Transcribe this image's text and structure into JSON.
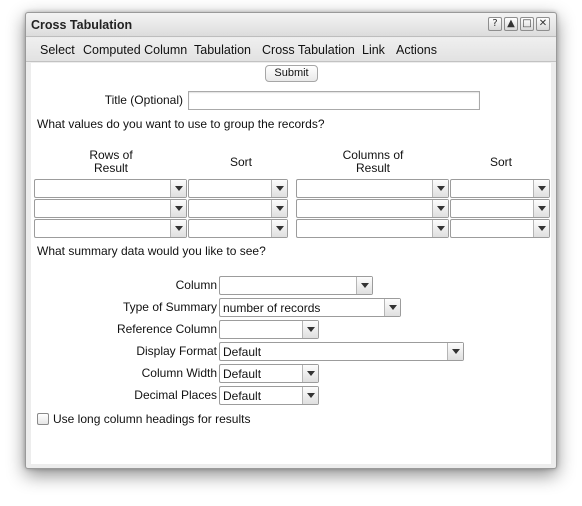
{
  "window": {
    "title": "Cross Tabulation",
    "buttons": {
      "help": "?",
      "collapse": "▲",
      "maximize": "□",
      "close": "✕"
    }
  },
  "menu": [
    "Select",
    "Computed Column",
    "Tabulation",
    "Cross Tabulation",
    "Link",
    "Actions"
  ],
  "form": {
    "submit_label": "Submit",
    "title_label": "Title (Optional)",
    "title_value": "",
    "group_question": "What values do you want to use to group the records?",
    "group_headers": {
      "rows_of_result": "Rows of Result",
      "sort_rows": "Sort",
      "columns_of_result": "Columns of Result",
      "sort_columns": "Sort"
    },
    "summary_question": "What summary data would you like to see?",
    "fields": {
      "column": {
        "label": "Column",
        "value": ""
      },
      "type_of_summary": {
        "label": "Type of Summary",
        "value": "number of records"
      },
      "reference_column": {
        "label": "Reference Column",
        "value": ""
      },
      "display_format": {
        "label": "Display Format",
        "value": "Default"
      },
      "column_width": {
        "label": "Column Width",
        "value": "Default"
      },
      "decimal_places": {
        "label": "Decimal Places",
        "value": "Default"
      }
    },
    "long_headings_label": "Use long column headings for results",
    "long_headings_checked": false
  },
  "colors": {
    "window_bg": "#ededed",
    "content_bg": "#ffffff",
    "border": "#9c9c9c"
  }
}
